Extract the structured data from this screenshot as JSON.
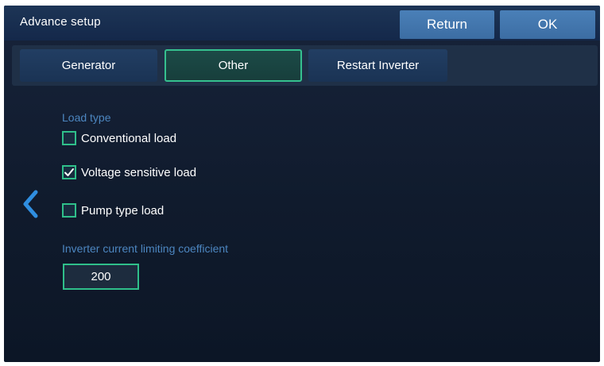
{
  "header": {
    "title": "Advance setup",
    "return_label": "Return",
    "ok_label": "OK"
  },
  "tabs": [
    {
      "label": "Generator",
      "selected": false
    },
    {
      "label": "Other",
      "selected": true
    },
    {
      "label": "Restart Inverter",
      "selected": false
    }
  ],
  "load_type": {
    "label": "Load type",
    "options": [
      {
        "label": "Conventional load",
        "checked": false
      },
      {
        "label": "Voltage sensitive load",
        "checked": true
      },
      {
        "label": "Pump type load",
        "checked": false
      }
    ]
  },
  "coefficient": {
    "label": "Inverter current limiting coefficient",
    "value": "200"
  },
  "colors": {
    "accent_green": "#2fbf8a",
    "button_blue": "#4a80b8",
    "label_blue": "#4c86c0",
    "background": "#101b2d"
  },
  "icons": {
    "back": "chevron-left-icon",
    "check": "checkmark-icon"
  }
}
